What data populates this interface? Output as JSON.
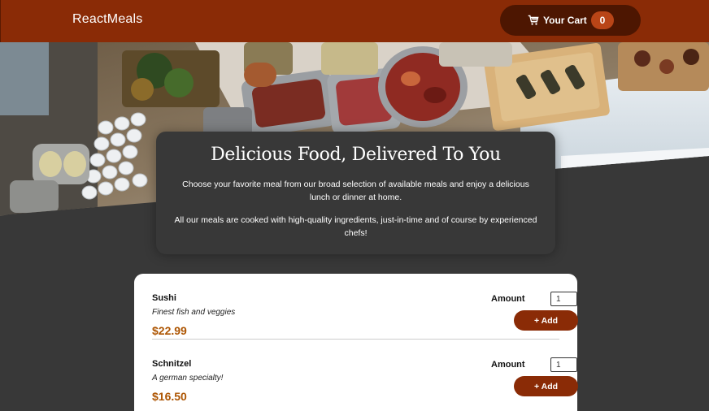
{
  "header": {
    "brand": "ReactMeals",
    "cart_label": "Your Cart",
    "cart_count": "0"
  },
  "summary": {
    "title": "Delicious Food, Delivered To You",
    "paragraph_1": "Choose your favorite meal from our broad selection of available meals and enjoy a delicious lunch or dinner at home.",
    "paragraph_2": "All our meals are cooked with high-quality ingredients, just-in-time and of course by experienced chefs!"
  },
  "meals": [
    {
      "name": "Sushi",
      "description": "Finest fish and veggies",
      "price": "$22.99",
      "amount_label": "Amount",
      "amount_value": "1",
      "add_label": "+ Add"
    },
    {
      "name": "Schnitzel",
      "description": "A german specialty!",
      "price": "$16.50",
      "amount_label": "Amount",
      "amount_value": "1",
      "add_label": "+ Add"
    }
  ],
  "colors": {
    "header_bg": "#8a2b06",
    "cart_bg": "#4d1601",
    "badge_bg": "#b94517",
    "page_bg": "#383838",
    "price": "#ad5502"
  },
  "icons": {
    "cart": "shopping-cart-icon"
  }
}
